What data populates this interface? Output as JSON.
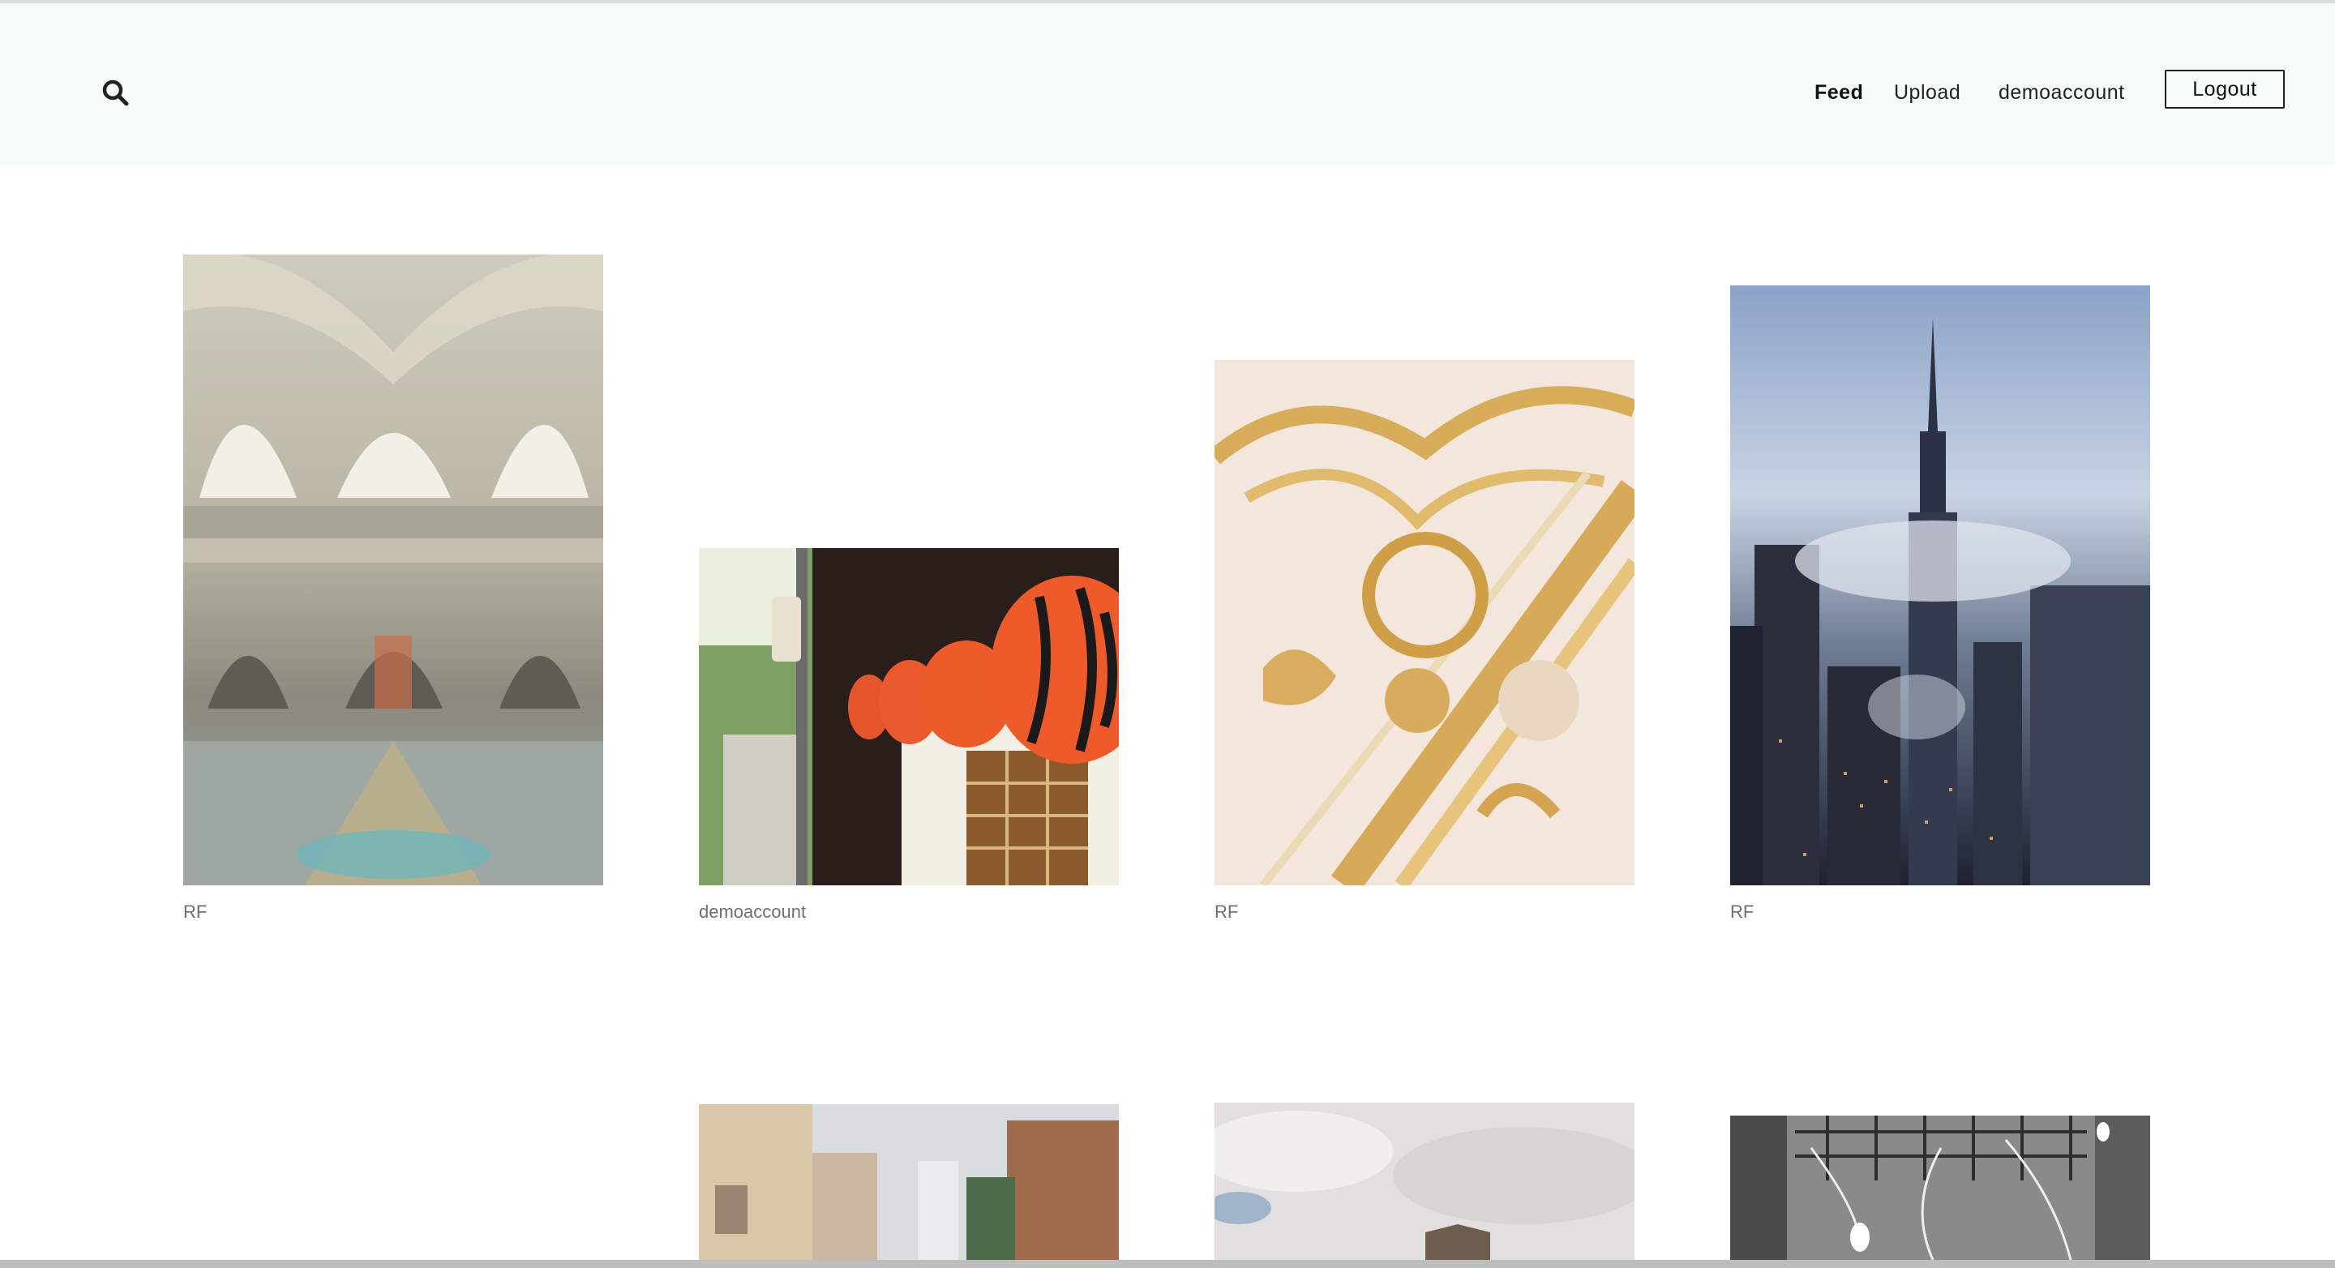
{
  "header": {
    "search_icon": "search-icon",
    "nav": [
      {
        "label": "Feed",
        "active": true
      },
      {
        "label": "Upload",
        "active": false
      },
      {
        "label": "demoaccount",
        "active": false
      }
    ],
    "logout_label": "Logout"
  },
  "feed": {
    "posts": [
      {
        "owner": "RF",
        "subject": "ornate palace hall interior"
      },
      {
        "owner": "demoaccount",
        "subject": "red paper lanterns on street"
      },
      {
        "owner": "RF",
        "subject": "gold baroque ceiling"
      },
      {
        "owner": "RF",
        "subject": "foggy city skyline with spire"
      },
      {
        "owner": "",
        "subject": "blurred city street buildings"
      },
      {
        "owner": "",
        "subject": "cloudy sky over building"
      },
      {
        "owner": "",
        "subject": "black and white room with light bulbs"
      }
    ]
  },
  "colors": {
    "header_bg": "#f5fbf7",
    "text": "#222222",
    "owner_text": "#6f6f6f"
  }
}
